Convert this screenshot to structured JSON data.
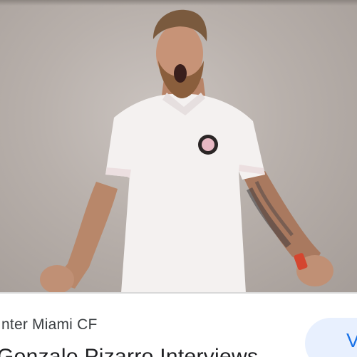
{
  "result": {
    "source": "Inter Miami CF",
    "headline": "Gonzalo Pizarro Interviews",
    "visit_label": "Visit"
  },
  "colors": {
    "accent": "#1a73e8",
    "button_bg": "#e8f0fe",
    "text": "#202124"
  }
}
